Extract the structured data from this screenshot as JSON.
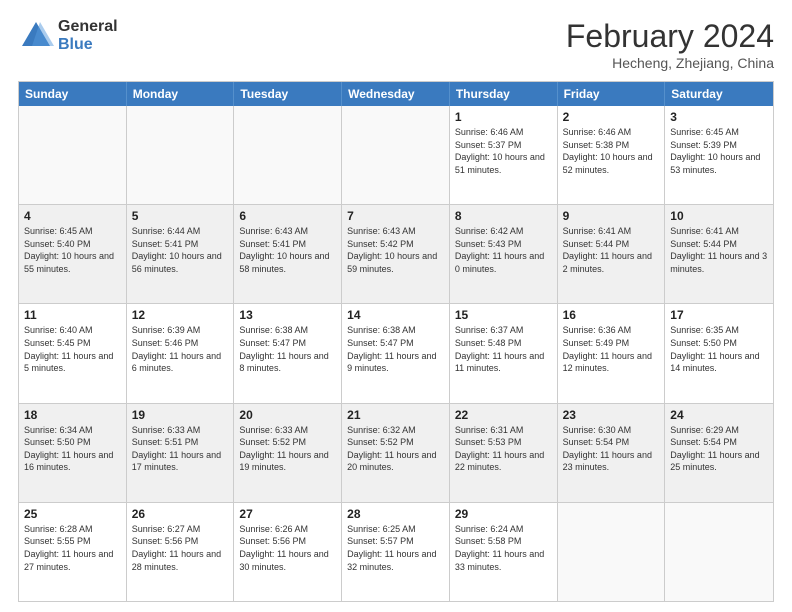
{
  "logo": {
    "general": "General",
    "blue": "Blue"
  },
  "title": "February 2024",
  "location": "Hecheng, Zhejiang, China",
  "days_of_week": [
    "Sunday",
    "Monday",
    "Tuesday",
    "Wednesday",
    "Thursday",
    "Friday",
    "Saturday"
  ],
  "weeks": [
    [
      {
        "day": "",
        "info": "",
        "empty": true
      },
      {
        "day": "",
        "info": "",
        "empty": true
      },
      {
        "day": "",
        "info": "",
        "empty": true
      },
      {
        "day": "",
        "info": "",
        "empty": true
      },
      {
        "day": "1",
        "info": "Sunrise: 6:46 AM\nSunset: 5:37 PM\nDaylight: 10 hours and 51 minutes."
      },
      {
        "day": "2",
        "info": "Sunrise: 6:46 AM\nSunset: 5:38 PM\nDaylight: 10 hours and 52 minutes."
      },
      {
        "day": "3",
        "info": "Sunrise: 6:45 AM\nSunset: 5:39 PM\nDaylight: 10 hours and 53 minutes."
      }
    ],
    [
      {
        "day": "4",
        "info": "Sunrise: 6:45 AM\nSunset: 5:40 PM\nDaylight: 10 hours and 55 minutes."
      },
      {
        "day": "5",
        "info": "Sunrise: 6:44 AM\nSunset: 5:41 PM\nDaylight: 10 hours and 56 minutes."
      },
      {
        "day": "6",
        "info": "Sunrise: 6:43 AM\nSunset: 5:41 PM\nDaylight: 10 hours and 58 minutes."
      },
      {
        "day": "7",
        "info": "Sunrise: 6:43 AM\nSunset: 5:42 PM\nDaylight: 10 hours and 59 minutes."
      },
      {
        "day": "8",
        "info": "Sunrise: 6:42 AM\nSunset: 5:43 PM\nDaylight: 11 hours and 0 minutes."
      },
      {
        "day": "9",
        "info": "Sunrise: 6:41 AM\nSunset: 5:44 PM\nDaylight: 11 hours and 2 minutes."
      },
      {
        "day": "10",
        "info": "Sunrise: 6:41 AM\nSunset: 5:44 PM\nDaylight: 11 hours and 3 minutes."
      }
    ],
    [
      {
        "day": "11",
        "info": "Sunrise: 6:40 AM\nSunset: 5:45 PM\nDaylight: 11 hours and 5 minutes."
      },
      {
        "day": "12",
        "info": "Sunrise: 6:39 AM\nSunset: 5:46 PM\nDaylight: 11 hours and 6 minutes."
      },
      {
        "day": "13",
        "info": "Sunrise: 6:38 AM\nSunset: 5:47 PM\nDaylight: 11 hours and 8 minutes."
      },
      {
        "day": "14",
        "info": "Sunrise: 6:38 AM\nSunset: 5:47 PM\nDaylight: 11 hours and 9 minutes."
      },
      {
        "day": "15",
        "info": "Sunrise: 6:37 AM\nSunset: 5:48 PM\nDaylight: 11 hours and 11 minutes."
      },
      {
        "day": "16",
        "info": "Sunrise: 6:36 AM\nSunset: 5:49 PM\nDaylight: 11 hours and 12 minutes."
      },
      {
        "day": "17",
        "info": "Sunrise: 6:35 AM\nSunset: 5:50 PM\nDaylight: 11 hours and 14 minutes."
      }
    ],
    [
      {
        "day": "18",
        "info": "Sunrise: 6:34 AM\nSunset: 5:50 PM\nDaylight: 11 hours and 16 minutes."
      },
      {
        "day": "19",
        "info": "Sunrise: 6:33 AM\nSunset: 5:51 PM\nDaylight: 11 hours and 17 minutes."
      },
      {
        "day": "20",
        "info": "Sunrise: 6:33 AM\nSunset: 5:52 PM\nDaylight: 11 hours and 19 minutes."
      },
      {
        "day": "21",
        "info": "Sunrise: 6:32 AM\nSunset: 5:52 PM\nDaylight: 11 hours and 20 minutes."
      },
      {
        "day": "22",
        "info": "Sunrise: 6:31 AM\nSunset: 5:53 PM\nDaylight: 11 hours and 22 minutes."
      },
      {
        "day": "23",
        "info": "Sunrise: 6:30 AM\nSunset: 5:54 PM\nDaylight: 11 hours and 23 minutes."
      },
      {
        "day": "24",
        "info": "Sunrise: 6:29 AM\nSunset: 5:54 PM\nDaylight: 11 hours and 25 minutes."
      }
    ],
    [
      {
        "day": "25",
        "info": "Sunrise: 6:28 AM\nSunset: 5:55 PM\nDaylight: 11 hours and 27 minutes."
      },
      {
        "day": "26",
        "info": "Sunrise: 6:27 AM\nSunset: 5:56 PM\nDaylight: 11 hours and 28 minutes."
      },
      {
        "day": "27",
        "info": "Sunrise: 6:26 AM\nSunset: 5:56 PM\nDaylight: 11 hours and 30 minutes."
      },
      {
        "day": "28",
        "info": "Sunrise: 6:25 AM\nSunset: 5:57 PM\nDaylight: 11 hours and 32 minutes."
      },
      {
        "day": "29",
        "info": "Sunrise: 6:24 AM\nSunset: 5:58 PM\nDaylight: 11 hours and 33 minutes."
      },
      {
        "day": "",
        "info": "",
        "empty": true
      },
      {
        "day": "",
        "info": "",
        "empty": true
      }
    ]
  ]
}
